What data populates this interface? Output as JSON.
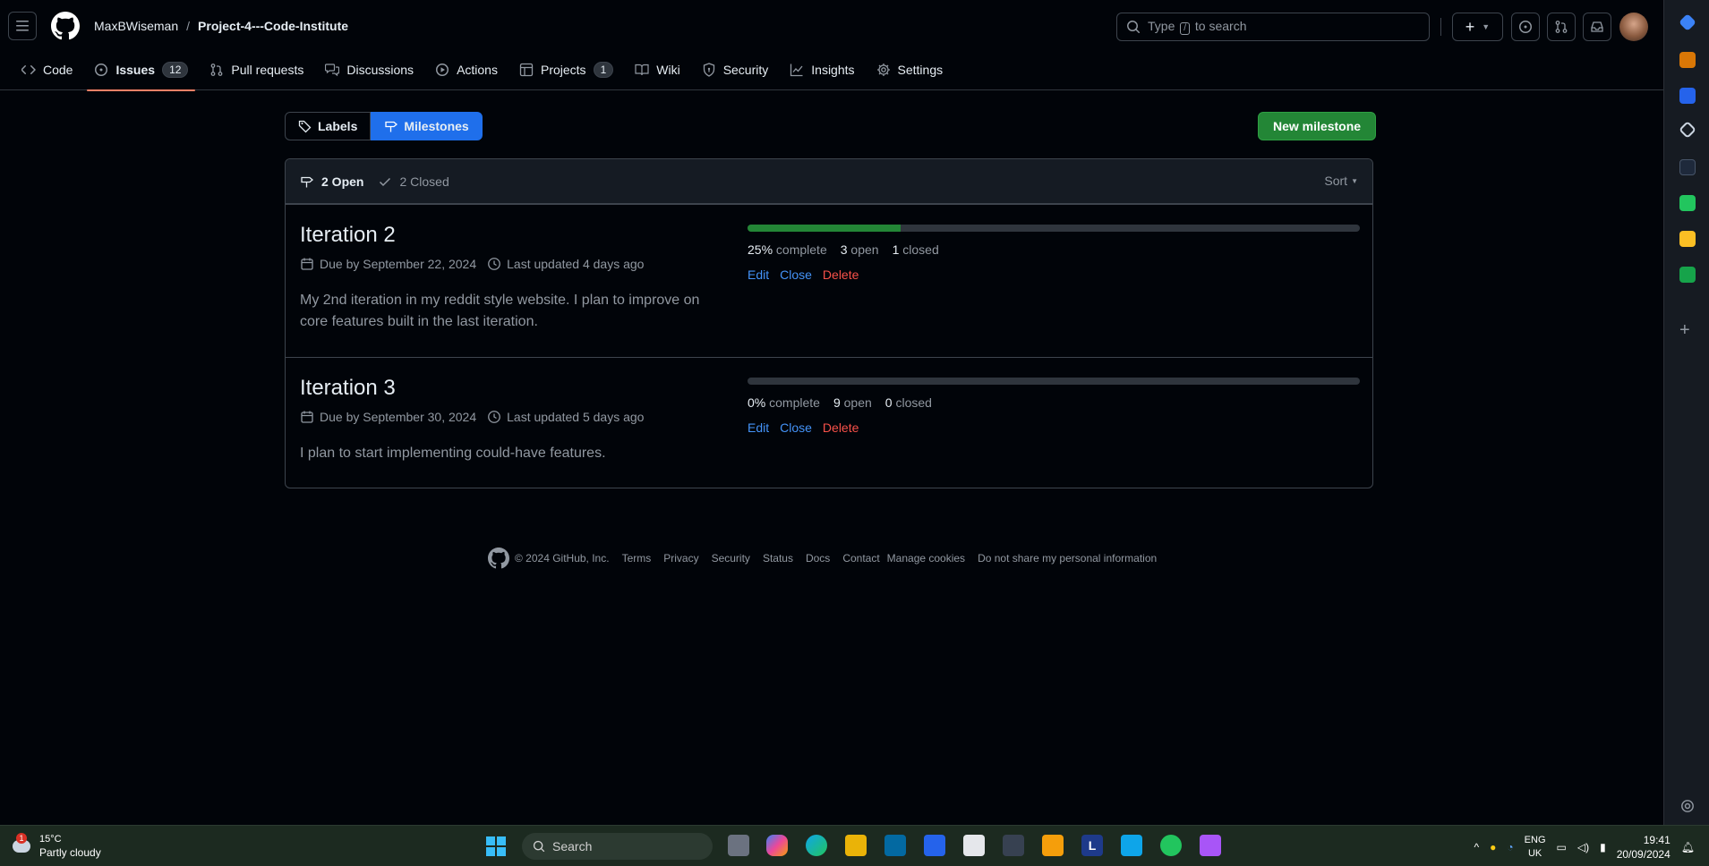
{
  "header": {
    "owner": "MaxBWiseman",
    "separator": "/",
    "repo": "Project-4---Code-Institute",
    "search_prefix": "Type",
    "search_key": "/",
    "search_suffix": "to search"
  },
  "tabs": [
    {
      "label": "Code",
      "icon": "code-icon"
    },
    {
      "label": "Issues",
      "icon": "issue-opened-icon",
      "count": "12",
      "active": true
    },
    {
      "label": "Pull requests",
      "icon": "git-pull-request-icon"
    },
    {
      "label": "Discussions",
      "icon": "comment-discussion-icon"
    },
    {
      "label": "Actions",
      "icon": "play-icon"
    },
    {
      "label": "Projects",
      "icon": "table-icon",
      "count": "1"
    },
    {
      "label": "Wiki",
      "icon": "book-icon"
    },
    {
      "label": "Security",
      "icon": "shield-icon"
    },
    {
      "label": "Insights",
      "icon": "graph-icon"
    },
    {
      "label": "Settings",
      "icon": "gear-icon"
    }
  ],
  "subnav": {
    "labels": "Labels",
    "milestones": "Milestones",
    "new_milestone": "New milestone"
  },
  "filter": {
    "open": "2 Open",
    "closed": "2 Closed",
    "sort": "Sort"
  },
  "milestones": [
    {
      "title": "Iteration 2",
      "due": "Due by September 22, 2024",
      "updated": "Last updated 4 days ago",
      "description": "My 2nd iteration in my reddit style website. I plan to improve on core features built in the last iteration.",
      "progress": 0.25,
      "percent": "25%",
      "complete_label": "complete",
      "open_count": "3",
      "open_label": "open",
      "closed_count": "1",
      "closed_label": "closed",
      "edit": "Edit",
      "close": "Close",
      "delete": "Delete"
    },
    {
      "title": "Iteration 3",
      "due": "Due by September 30, 2024",
      "updated": "Last updated 5 days ago",
      "description": "I plan to start implementing could-have features.",
      "progress": 0,
      "percent": "0%",
      "complete_label": "complete",
      "open_count": "9",
      "open_label": "open",
      "closed_count": "0",
      "closed_label": "closed",
      "edit": "Edit",
      "close": "Close",
      "delete": "Delete"
    }
  ],
  "footer": {
    "copyright": "© 2024 GitHub, Inc.",
    "links": [
      "Terms",
      "Privacy",
      "Security",
      "Status",
      "Docs",
      "Contact",
      "Manage cookies",
      "Do not share my personal information"
    ]
  },
  "taskbar": {
    "weather_temp": "15°C",
    "weather_desc": "Partly cloudy",
    "weather_badge": "1",
    "search": "Search",
    "lang_top": "ENG",
    "lang_bottom": "UK",
    "time": "19:41",
    "date": "20/09/2024"
  },
  "colors": {
    "accent": "#1f6feb",
    "success": "#238636",
    "danger": "#f85149",
    "link": "#4493f8",
    "tab_underline": "#f78166"
  }
}
